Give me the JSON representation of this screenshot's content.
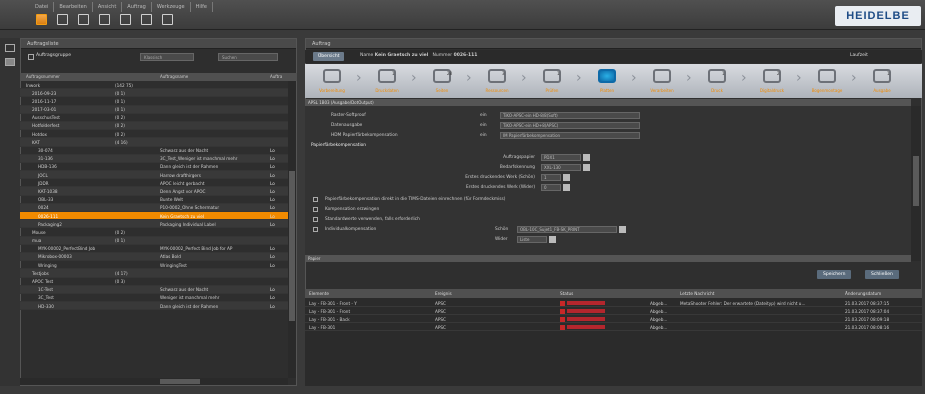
{
  "menu": [
    "Datei",
    "Bearbeiten",
    "Ansicht",
    "Auftrag",
    "Werkzeuge",
    "Hilfe"
  ],
  "brand": "HEIDELBE",
  "left_panel": {
    "title": "Auftragsliste",
    "group_by_label": "Auftragsgruppe",
    "filter_value": "Klassisch",
    "search_placeholder": "Suchen",
    "columns": [
      "Auftragsnummer",
      "Auftragsname",
      "Auftra"
    ],
    "rows": [
      {
        "indent": 0,
        "id": "Inwork",
        "count": "(142 75)",
        "name": "",
        "status": ""
      },
      {
        "indent": 1,
        "id": "2016-09-23",
        "count": "(0 1)",
        "name": "",
        "status": ""
      },
      {
        "indent": 1,
        "id": "2016-11-17",
        "count": "(0 1)",
        "name": "",
        "status": ""
      },
      {
        "indent": 1,
        "id": "2017-03-01",
        "count": "(0 1)",
        "name": "",
        "status": ""
      },
      {
        "indent": 1,
        "id": "AusschusTest",
        "count": "(0 2)",
        "name": "",
        "status": ""
      },
      {
        "indent": 1,
        "id": "Hotfolderfest",
        "count": "(0 2)",
        "name": "",
        "status": ""
      },
      {
        "indent": 1,
        "id": "Hotdox",
        "count": "(0 2)",
        "name": "",
        "status": ""
      },
      {
        "indent": 1,
        "id": "KAT",
        "count": "(4 16)",
        "name": "",
        "status": ""
      },
      {
        "indent": 2,
        "id": "30-074",
        "count": "",
        "name": "Schwarz aus der Nacht",
        "status": "Lo"
      },
      {
        "indent": 2,
        "id": "31-136",
        "count": "",
        "name": "3C_Test_Weniger ist manchmal mehr",
        "status": "Lo"
      },
      {
        "indent": 2,
        "id": "HDB-136",
        "count": "",
        "name": "Dann gleich ist der Rahmen",
        "status": "Lo"
      },
      {
        "indent": 2,
        "id": "JOCL",
        "count": "",
        "name": "Harrow drafthirgers",
        "status": "Lo"
      },
      {
        "indent": 2,
        "id": "JDDR",
        "count": "",
        "name": "APOC leicht gerbacht",
        "status": "Lo"
      },
      {
        "indent": 2,
        "id": "KAT-1038",
        "count": "",
        "name": "Denn Angst vor APOC",
        "status": "Lo"
      },
      {
        "indent": 2,
        "id": "OBL-33",
        "count": "",
        "name": "Bunte Welt",
        "status": "Lo"
      },
      {
        "indent": 2,
        "id": "0024",
        "count": "",
        "name": "P10-0002_Ohne Schermatur",
        "status": "Lo"
      },
      {
        "indent": 2,
        "id": "0026-111",
        "count": "",
        "name": "Kein Graetsch zu viel",
        "status": "Lo",
        "selected": true
      },
      {
        "indent": 2,
        "id": "Packaging2",
        "count": "",
        "name": "Packaging Individual Label",
        "status": "Lo"
      },
      {
        "indent": 1,
        "id": "Mouse",
        "count": "(0 2)",
        "name": "",
        "status": ""
      },
      {
        "indent": 1,
        "id": "mua",
        "count": "(0 1)",
        "name": "",
        "status": ""
      },
      {
        "indent": 2,
        "id": "MYK-00002_PerfectBind Job",
        "count": "",
        "name": "MYK-00002_Perfect Bind Job for AP",
        "status": "Lo"
      },
      {
        "indent": 2,
        "id": "Mikrobox-00003",
        "count": "",
        "name": "Atlas Bold",
        "status": "Lo"
      },
      {
        "indent": 2,
        "id": "Wringing",
        "count": "",
        "name": "WringingTest",
        "status": "Lo"
      },
      {
        "indent": 1,
        "id": "Testjobs",
        "count": "(4 17)",
        "name": "",
        "status": ""
      },
      {
        "indent": 1,
        "id": "APOC Test",
        "count": "(0 3)",
        "name": "",
        "status": ""
      },
      {
        "indent": 2,
        "id": "1C-Test",
        "count": "",
        "name": "Schwarz aus der Nacht",
        "status": "Lo"
      },
      {
        "indent": 2,
        "id": "3C_Test",
        "count": "",
        "name": "Weniger ist manchmal mehr",
        "status": "Lo"
      },
      {
        "indent": 2,
        "id": "HD-330",
        "count": "",
        "name": "Dann gleich ist der Rahmen",
        "status": "Lo"
      }
    ]
  },
  "right_panel": {
    "title": "Auftrag",
    "overview_tab": "Übersicht",
    "job_name_label": "Name",
    "job_name": "Kein Graetsch zu viel",
    "job_number_label": "Nummer",
    "job_number": "0026-111",
    "run_button": "Laufzeit",
    "steps": [
      {
        "label": "Vorbereitung",
        "count": ""
      },
      {
        "label": "Druckdaten",
        "count": "1"
      },
      {
        "label": "Seiten",
        "count": "28"
      },
      {
        "label": "Ressourcen",
        "count": "3"
      },
      {
        "label": "Prüfen",
        "count": "1"
      },
      {
        "label": "Platten",
        "count": ""
      },
      {
        "label": "Verarbeiten",
        "count": ""
      },
      {
        "label": "Druck",
        "count": "1"
      },
      {
        "label": "Digitaldruck",
        "count": "2"
      },
      {
        "label": "Bogenmontage",
        "count": ""
      },
      {
        "label": "Ausgabe",
        "count": "1"
      }
    ],
    "section_title": "APSL 1B03 (Ausgabe/DotOutput)",
    "rows_top": [
      {
        "label": "Raster-Softproof",
        "on": "ein",
        "value": "TiKO-APSC-ein HD-8/8(Soft)"
      },
      {
        "label": "Datenausgabe",
        "on": "ein",
        "value": "TiKO-APSC-ein HD+8(APSC)"
      },
      {
        "label": "HDM Papierfärbekompensation",
        "on": "ein",
        "value": "IM Papierfärbekompensation"
      }
    ],
    "subsection": "Papierfärbekompensation",
    "fields": [
      {
        "label": "Auftragspapier",
        "value": "PDX1"
      },
      {
        "label": "Bedarfskennung",
        "value": "XXL-130"
      },
      {
        "label": "Erstes druckendes Werk (Schön)",
        "value": "1"
      },
      {
        "label": "Erstes druckendes Werk (Wider)",
        "value": "0"
      }
    ],
    "checks": [
      "Papierfärbekompensation direkt in die TIMS-Dateien einrechnen (für Formdeckmiss)",
      "Kompensation erzwingen",
      "Standardwerte verwenden, falls erforderlich",
      "Individualkompensation"
    ],
    "indiv_source_label": "Schön",
    "indiv_source_value": "OBL-10C_Sujet1_FB-SK_PRINT",
    "indiv_wider_label": "Wider",
    "indiv_wider_value": "Liste",
    "paper_section": "Papier",
    "save_button": "Speichern",
    "close_button": "Schließen"
  },
  "message_table": {
    "columns": [
      "Elemente",
      "Ereignis",
      "Status",
      "Letzte Nachricht",
      "Änderungsdatum"
    ],
    "rows": [
      {
        "element": "Lay - FB-301 - Front - Y",
        "event": "APSC",
        "status": "Abgeb...",
        "message": "MetaShooter Fehler: Der erwartete (Dateityp) wird nicht u...",
        "date": "21.03.2017 08:37:15"
      },
      {
        "element": "Lay - FB-301 - Front",
        "event": "APSC",
        "status": "Abgeb...",
        "message": "",
        "date": "21.03.2017 08:37:04"
      },
      {
        "element": "Lay - FB-301 - Back",
        "event": "APSC",
        "status": "Abgeb...",
        "message": "",
        "date": "21.03.2017 08:09:18"
      },
      {
        "element": "Lay - FB-301",
        "event": "APSC",
        "status": "Abgeb...",
        "message": "",
        "date": "21.03.2017 08:08:16"
      }
    ]
  }
}
